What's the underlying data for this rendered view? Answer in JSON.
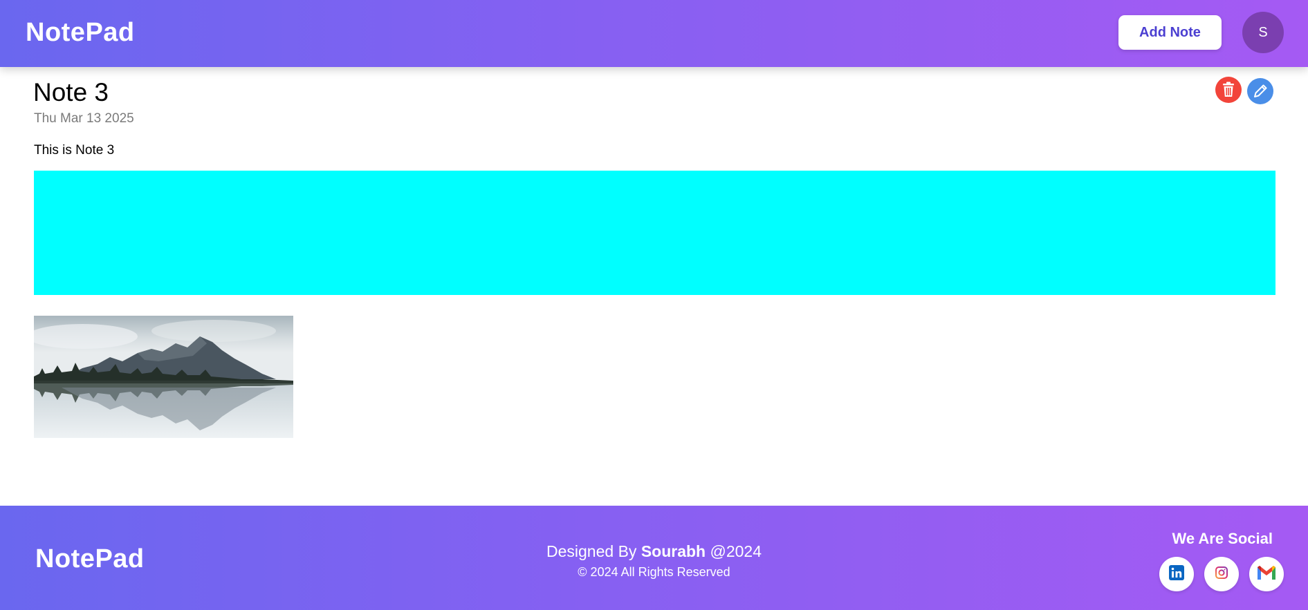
{
  "header": {
    "brand": "NotePad",
    "add_note_label": "Add Note",
    "avatar_initial": "S"
  },
  "note": {
    "title": "Note 3",
    "date": "Thu Mar 13 2025",
    "body": "This is Note 3",
    "block_color": "#00ffff",
    "image_icon": "mountain-lake-image"
  },
  "actions": {
    "delete_icon": "trash-icon",
    "delete_color": "#f2443a",
    "edit_icon": "pencil-icon",
    "edit_color": "#4a8ee8"
  },
  "footer": {
    "brand": "NotePad",
    "designed_prefix": "Designed By",
    "designer": "Sourabh",
    "year_suffix": "@2024",
    "copyright": "© 2024 All Rights Reserved",
    "social_title": "We Are Social",
    "social": [
      {
        "name": "linkedin",
        "icon": "linkedin-icon"
      },
      {
        "name": "instagram",
        "icon": "instagram-icon"
      },
      {
        "name": "gmail",
        "icon": "gmail-icon"
      }
    ]
  },
  "colors": {
    "gradient_start": "#6a67ef",
    "gradient_end": "#a55af3",
    "avatar_bg": "#7b3fb0",
    "button_text": "#4b3fd1"
  }
}
